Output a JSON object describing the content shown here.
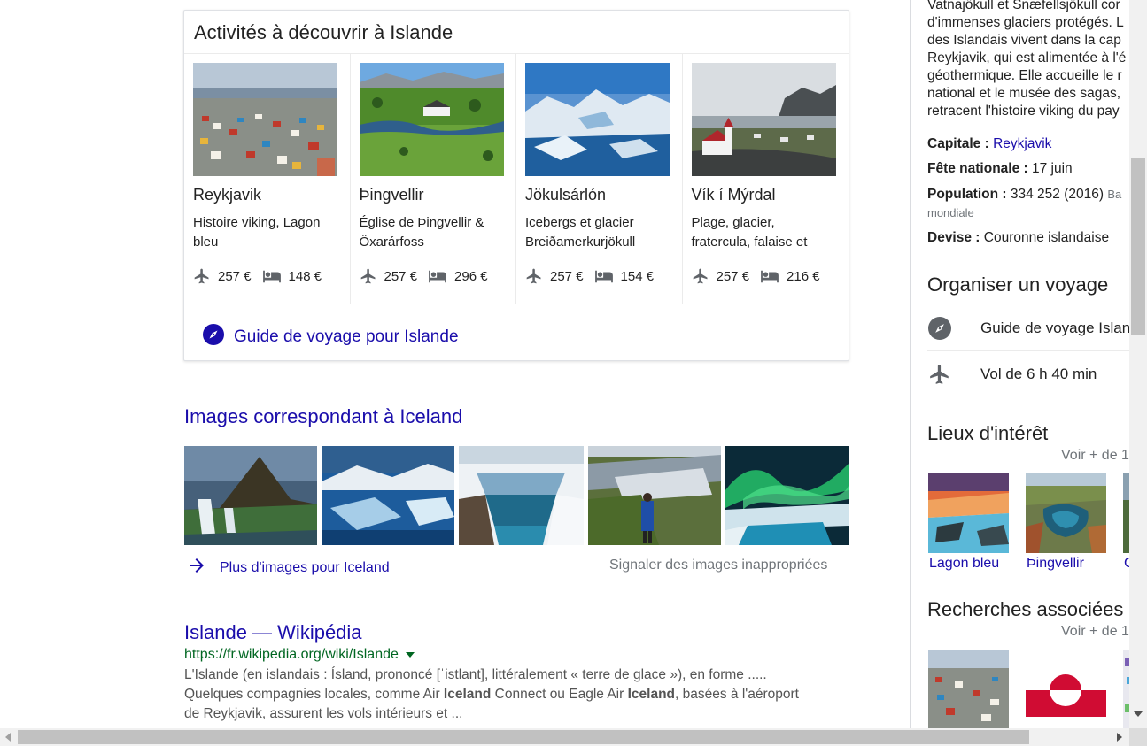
{
  "activities": {
    "title": "Activités à découvrir à Islande",
    "tiles": [
      {
        "name": "Reykjavik",
        "description": "Histoire viking, Lagon bleu",
        "flight_price": "257 €",
        "hotel_price": "148 €"
      },
      {
        "name": "Þingvellir",
        "description": "Église de Þingvellir & Öxarárfoss",
        "flight_price": "257 €",
        "hotel_price": "296 €"
      },
      {
        "name": "Jökulsárlón",
        "description": "Icebergs et glacier Breiðamerkurjökull",
        "flight_price": "257 €",
        "hotel_price": "154 €"
      },
      {
        "name": "Vík í Mýrdal",
        "description": "Plage, glacier, fratercula, falaise et",
        "flight_price": "257 €",
        "hotel_price": "216 €"
      }
    ],
    "guide_link": "Guide de voyage pour Islande"
  },
  "images": {
    "heading": "Images correspondant à Iceland",
    "more_link": "Plus d'images pour Iceland",
    "report_link": "Signaler des images inappropriées"
  },
  "result": {
    "title": "Islande — Wikipédia",
    "url": "https://fr.wikipedia.org/wiki/Islande",
    "snippet_line1": "L'Islande (en islandais : Ísland, prononcé [ˈistlant], littéralement « terre de glace »), en forme .....",
    "snippet_line2_a": "Quelques compagnies locales, comme Air ",
    "snippet_line2_b": "Iceland",
    "snippet_line2_c": " Connect ou Eagle Air ",
    "snippet_line2_d": "Iceland",
    "snippet_line2_e": ", basées à l'aéroport",
    "snippet_line3": "de Reykjavik, assurent les vols intérieurs et ..."
  },
  "knowledge_panel": {
    "description_lines": [
      "Vatnajökull et Snæfellsjökull cor",
      "d'immenses glaciers protégés. L",
      "des Islandais vivent dans la cap",
      "Reykjavik, qui est alimentée à l'é",
      "géothermique. Elle accueille le r",
      "national et le musée des sagas,",
      "retracent l'histoire viking du pay"
    ],
    "facts": {
      "capital_label": "Capitale :",
      "capital_value": "Reykjavik",
      "national_day_label": "Fête nationale :",
      "national_day_value": "17 juin",
      "population_label": "Population :",
      "population_value": "334 252 (2016)",
      "population_source_a": "Ba",
      "population_source_b": "mondiale",
      "currency_label": "Devise :",
      "currency_value": "Couronne islandaise"
    },
    "plan_trip": {
      "heading": "Organiser un voyage",
      "guide": "Guide de voyage Islan",
      "flight": "Vol de 6 h 40 min"
    },
    "points_of_interest": {
      "heading": "Lieux d'intérêt",
      "more": "Voir + de 1",
      "items": [
        "Lagon bleu",
        "Þingvellir",
        "C"
      ]
    },
    "related": {
      "heading": "Recherches associées",
      "more": "Voir + de 1"
    }
  },
  "colors": {
    "link": "#1a0dab",
    "url_green": "#006621",
    "muted": "#70757a",
    "greenland_red": "#d00c33"
  }
}
